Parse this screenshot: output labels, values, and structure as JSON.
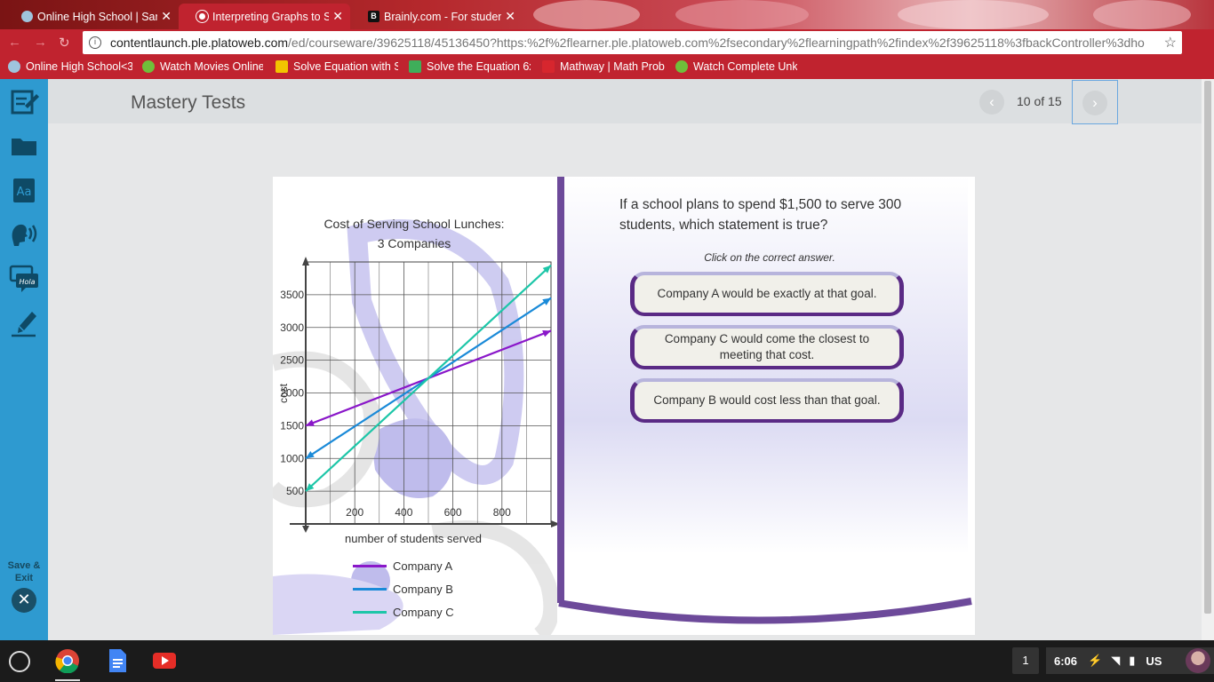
{
  "browser": {
    "tabs": [
      {
        "label": "Online High School | Sar",
        "active": false
      },
      {
        "label": "Interpreting Graphs to Sc",
        "active": true
      },
      {
        "label": "Brainly.com - For studen",
        "active": false
      }
    ],
    "url_host": "contentlaunch.ple.platoweb.com",
    "url_path": "/ed/courseware/39625118/45136450?https:%2f%2flearner.ple.platoweb.com%2fsecondary%2flearningpath%2findex%2f39625118%3fbackController%3dho",
    "bookmarks": [
      "Online High School<3",
      "Watch Movies Online",
      "Solve Equation with S",
      "Solve the Equation 6x",
      "Mathway | Math Prob",
      "Watch Complete Unk"
    ],
    "bookmark_icons": [
      "globe-icon",
      "play-icon",
      "q-icon",
      "c-icon",
      "mathway-icon",
      "play-icon"
    ]
  },
  "sidebar": {
    "tools": [
      "notepad-icon",
      "folder-icon",
      "dictionary-icon",
      "text-to-speech-icon",
      "translate-icon",
      "highlighter-icon"
    ],
    "hola_text": "Hola",
    "dictionary_text": "Aa",
    "save_exit_label": "Save & Exit"
  },
  "header": {
    "title": "Mastery Tests",
    "progress_text": "10 of 15"
  },
  "chart": {
    "title_line1": "Cost of Serving School Lunches:",
    "title_line2": "3 Companies",
    "xlabel": "number of students served",
    "ylabel": "cost"
  },
  "chart_data": {
    "type": "line",
    "title": "Cost of Serving School Lunches: 3 Companies",
    "xlabel": "number of students served",
    "ylabel": "cost",
    "xlim": [
      0,
      1000
    ],
    "ylim": [
      0,
      4000
    ],
    "x_ticks": [
      200,
      400,
      600,
      800
    ],
    "y_ticks": [
      500,
      1000,
      1500,
      2000,
      2500,
      3000,
      3500
    ],
    "x_tick_labels": [
      "200",
      "400",
      "600",
      "800"
    ],
    "y_tick_labels": [
      "500",
      "1000",
      "1500",
      "2000",
      "2500",
      "3000",
      "3500"
    ],
    "grid": true,
    "series": [
      {
        "name": "Company A",
        "color": "#8a17c9",
        "x": [
          0,
          1000
        ],
        "y": [
          1500,
          2950
        ]
      },
      {
        "name": "Company B",
        "color": "#1a8ad8",
        "x": [
          0,
          1000
        ],
        "y": [
          1000,
          3450
        ]
      },
      {
        "name": "Company C",
        "color": "#1dc6a8",
        "x": [
          0,
          1000
        ],
        "y": [
          500,
          3950
        ]
      }
    ]
  },
  "question": {
    "text": "If a school plans to spend $1,500 to serve 300 students, which statement is true?",
    "instruction": "Click on the correct answer.",
    "answers": [
      "Company A would be exactly at that goal.",
      "Company C would come the closest to meeting that cost.",
      "Company B would cost less than that goal."
    ]
  },
  "taskbar": {
    "apps": [
      "chrome-icon",
      "docs-icon",
      "youtube-icon"
    ],
    "workspace": "1",
    "time": "6:06",
    "locale": "US"
  }
}
